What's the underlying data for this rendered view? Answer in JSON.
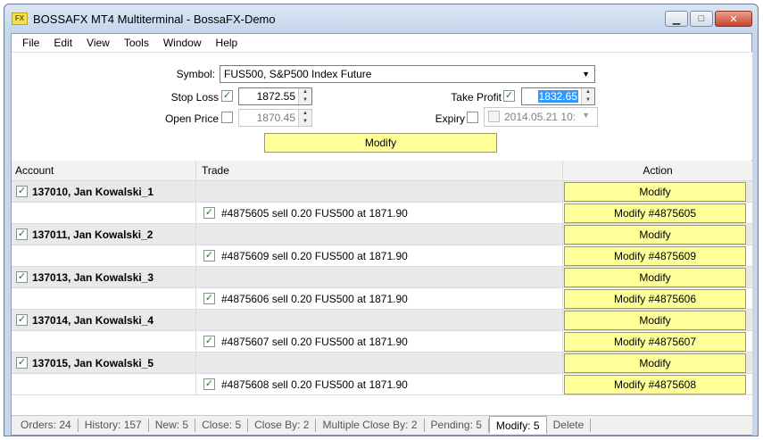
{
  "window": {
    "title": "BOSSAFX MT4 Multiterminal - BossaFX-Demo",
    "app_icon_text": "FX",
    "minimize": "▁",
    "maximize": "□",
    "close": "✕"
  },
  "menu": [
    "File",
    "Edit",
    "View",
    "Tools",
    "Window",
    "Help"
  ],
  "form": {
    "symbol_label": "Symbol:",
    "symbol_value": "FUS500,  S&P500 Index Future",
    "stop_loss_label": "Stop Loss",
    "stop_loss_value": "1872.55",
    "stop_loss_checked": true,
    "take_profit_label": "Take Profit",
    "take_profit_value": "1832.65",
    "take_profit_checked": true,
    "open_price_label": "Open Price",
    "open_price_value": "1870.45",
    "open_price_checked": false,
    "expiry_label": "Expiry",
    "expiry_value": "2014.05.21 10:",
    "expiry_checked": false,
    "modify_button": "Modify",
    "check_mark": "✓",
    "up_arrow": "▲",
    "down_arrow": "▼"
  },
  "grid": {
    "headers": {
      "account": "Account",
      "trade": "Trade",
      "action": "Action"
    },
    "groups": [
      {
        "account": "137010, Jan Kowalski_1",
        "account_action": "Modify",
        "trade": "#4875605 sell 0.20 FUS500 at 1871.90",
        "trade_action": "Modify #4875605"
      },
      {
        "account": "137011, Jan Kowalski_2",
        "account_action": "Modify",
        "trade": "#4875609 sell 0.20 FUS500 at 1871.90",
        "trade_action": "Modify #4875609"
      },
      {
        "account": "137013, Jan Kowalski_3",
        "account_action": "Modify",
        "trade": "#4875606 sell 0.20 FUS500 at 1871.90",
        "trade_action": "Modify #4875606"
      },
      {
        "account": "137014, Jan Kowalski_4",
        "account_action": "Modify",
        "trade": "#4875607 sell 0.20 FUS500 at 1871.90",
        "trade_action": "Modify #4875607"
      },
      {
        "account": "137015, Jan Kowalski_5",
        "account_action": "Modify",
        "trade": "#4875608 sell 0.20 FUS500 at 1871.90",
        "trade_action": "Modify #4875608"
      }
    ]
  },
  "status_tabs": [
    {
      "label": "Orders: 24",
      "active": false
    },
    {
      "label": "History: 157",
      "active": false
    },
    {
      "label": "New: 5",
      "active": false
    },
    {
      "label": "Close: 5",
      "active": false
    },
    {
      "label": "Close By: 2",
      "active": false
    },
    {
      "label": "Multiple Close By: 2",
      "active": false
    },
    {
      "label": "Pending: 5",
      "active": false
    },
    {
      "label": "Modify: 5",
      "active": true
    },
    {
      "label": "Delete",
      "active": false
    }
  ],
  "colors": {
    "button_yellow": "#ffff99",
    "account_row_bg": "#e9e9e9",
    "selection_blue": "#3399ff"
  }
}
